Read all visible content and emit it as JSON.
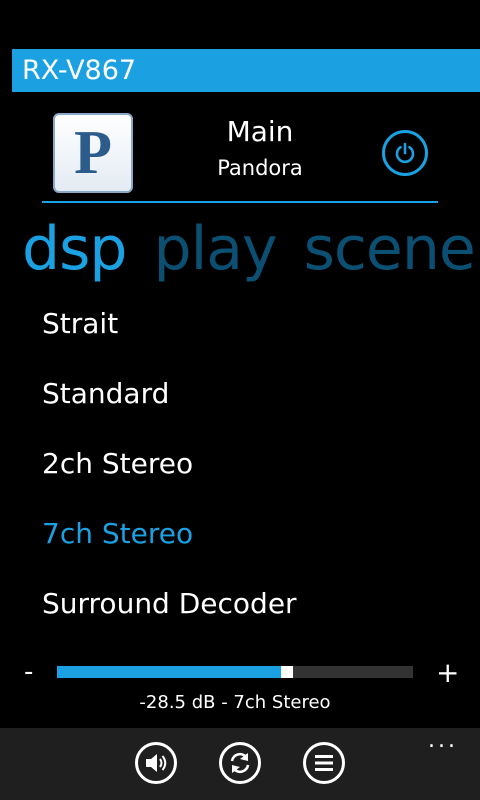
{
  "app": {
    "title": "RX-V867"
  },
  "header": {
    "logo_letter": "P",
    "zone": "Main",
    "source": "Pandora",
    "power_icon": "power-icon"
  },
  "pivot": {
    "items": [
      {
        "label": "dsp",
        "active": true
      },
      {
        "label": "play",
        "active": false
      },
      {
        "label": "scene",
        "active": false
      }
    ]
  },
  "dsp_list": {
    "selected_index": 3,
    "items": [
      "Strait",
      "Standard",
      "2ch Stereo",
      "7ch Stereo",
      "Surround Decoder"
    ]
  },
  "volume": {
    "minus_label": "-",
    "plus_label": "+",
    "level_fraction": 0.63,
    "status": "-28.5 dB - 7ch Stereo"
  },
  "app_bar": {
    "buttons": [
      "speaker-icon",
      "refresh-icon",
      "list-icon"
    ],
    "more_label": "..."
  },
  "colors": {
    "accent": "#1ba1e2",
    "inactive_pivot": "#0b4f72",
    "app_bar": "#1f1f1f"
  }
}
